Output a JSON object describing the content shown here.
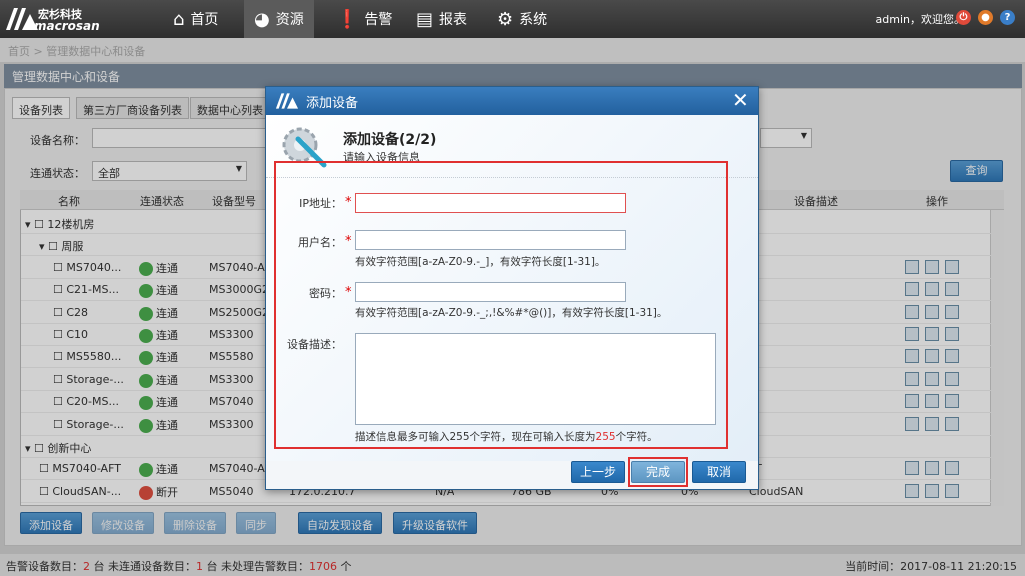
{
  "topbar": {
    "logo_cn": "宏杉科技",
    "logo_en": "macrosan",
    "nav": [
      {
        "label": "首页",
        "icon": "home-icon",
        "glyph": "⌂"
      },
      {
        "label": "资源",
        "icon": "pie-chart-icon",
        "glyph": "◕"
      },
      {
        "label": "告警",
        "icon": "alert-icon",
        "glyph": "❗"
      },
      {
        "label": "报表",
        "icon": "report-icon",
        "glyph": "▤"
      },
      {
        "label": "系统",
        "icon": "gear-icon",
        "glyph": "⚙"
      }
    ],
    "user_text": "admin，欢迎您。"
  },
  "breadcrumb": {
    "home": "首页",
    "sep": ">",
    "current": "管理数据中心和设备"
  },
  "panel_title": "管理数据中心和设备",
  "tabs": [
    "设备列表",
    "第三方厂商设备列表",
    "数据中心列表"
  ],
  "filters": {
    "name_label": "设备名称：",
    "status_label": "连通状态：",
    "status_value": "全部",
    "query_button": "查询"
  },
  "grid": {
    "headers": [
      "名称",
      "连通状态",
      "设备型号",
      "设备描述",
      "操作"
    ],
    "rows": [
      {
        "level": 0,
        "name": "12楼机房",
        "type": "group"
      },
      {
        "level": 1,
        "name": "周服",
        "type": "group"
      },
      {
        "level": 2,
        "name": "MS7040...",
        "status": "连通",
        "model": "MS7040-AF"
      },
      {
        "level": 2,
        "name": "C21-MS...",
        "status": "连通",
        "model": "MS3000G2"
      },
      {
        "level": 2,
        "name": "C28",
        "status": "连通",
        "model": "MS2500G2"
      },
      {
        "level": 2,
        "name": "C10",
        "status": "连通",
        "model": "MS3300"
      },
      {
        "level": 2,
        "name": "MS5580...",
        "status": "连通",
        "model": "MS5580"
      },
      {
        "level": 2,
        "name": "Storage-...",
        "status": "连通",
        "model": "MS3300"
      },
      {
        "level": 2,
        "name": "C20-MS...",
        "status": "连通",
        "model": "MS7040"
      },
      {
        "level": 2,
        "name": "Storage-...",
        "status": "连通",
        "model": "MS3300"
      },
      {
        "level": 0,
        "name": "创新中心",
        "type": "group"
      },
      {
        "level": 1,
        "name": "MS7040-AFT",
        "status": "连通",
        "model": "MS7040-AF",
        "desc": "FT"
      },
      {
        "level": 1,
        "name": "CloudSAN-...",
        "status": "断开",
        "model": "MS5040",
        "extra": "172.0.210.7",
        "state": "N/A",
        "size": "786 GB",
        "pct": "0%",
        "pct2": "0%",
        "desc": "CloudSAN"
      }
    ]
  },
  "bottom_buttons": [
    "添加设备",
    "修改设备",
    "删除设备",
    "同步",
    "自动发现设备",
    "升级设备软件"
  ],
  "statusbar": {
    "alarm_label": "告警设备数目：",
    "alarm_count": "2",
    "unit": "台",
    "disconnected_label": "未连通设备数目：",
    "disconnected_count": "1",
    "unhandled_label": "未处理告警数目：",
    "unhandled_count": "1706",
    "unhandled_unit": "个",
    "time_label": "当前时间：",
    "time_value": "2017-08-11 21:20:15"
  },
  "dialog": {
    "title": "添加设备",
    "step_title": "添加设备(2/2)",
    "step_subtitle": "请输入设备信息",
    "ip_label": "IP地址：",
    "username_label": "用户名：",
    "username_hint": "有效字符范围[a-zA-Z0-9.-_]，有效字符长度[1-31]。",
    "password_label": "密码：",
    "password_hint": "有效字符范围[a-zA-Z0-9.-_;,!&%#*@()]，有效字符长度[1-31]。",
    "desc_label": "设备描述：",
    "desc_hint_pre": "描述信息最多可输入255个字符，现在可输入长度为",
    "desc_hint_num": "255",
    "desc_hint_post": "个字符。",
    "required_mark": "*",
    "btn_prev": "上一步",
    "btn_finish": "完成",
    "btn_cancel": "取消"
  },
  "colors": {
    "highlight_red": "#e03030",
    "connected_green": "#4caf50",
    "disconnected_red": "#e05040",
    "dialog_blue": "#2a6aa8"
  }
}
